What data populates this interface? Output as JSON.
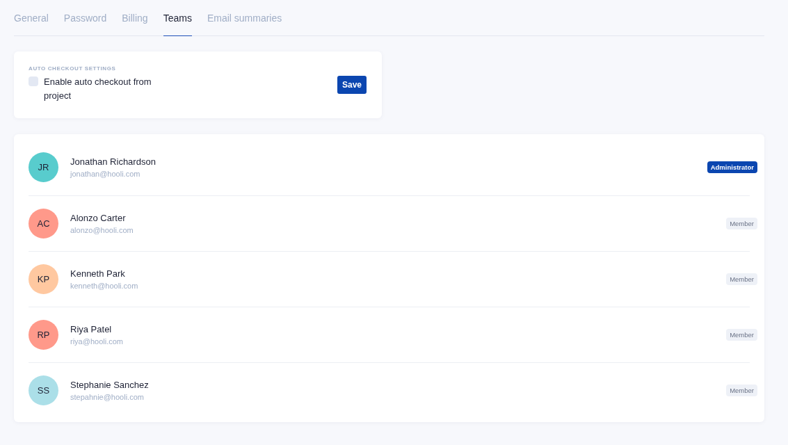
{
  "tabs": [
    {
      "label": "General",
      "selected": false
    },
    {
      "label": "Password",
      "selected": false
    },
    {
      "label": "Billing",
      "selected": false
    },
    {
      "label": "Teams",
      "selected": true
    },
    {
      "label": "Email summaries",
      "selected": false
    }
  ],
  "auto_checkout": {
    "heading": "AUTO CHECKOUT SETTINGS",
    "checkbox": {
      "label": "Enable auto checkout from project",
      "checked": false
    },
    "button": "Save"
  },
  "members": [
    {
      "initials": "JR",
      "color": "#58cccd",
      "name": "Jonathan Richardson",
      "email": "jonathan@hooli.com",
      "role": {
        "label": "Administrator",
        "kind": "admin"
      }
    },
    {
      "initials": "AC",
      "color": "#ff998a",
      "name": "Alonzo Carter",
      "email": "alonzo@hooli.com",
      "role": {
        "label": "Member",
        "kind": "member"
      }
    },
    {
      "initials": "KP",
      "color": "#ffc8a0",
      "name": "Kenneth Park",
      "email": "kenneth@hooli.com",
      "role": {
        "label": "Member",
        "kind": "member"
      }
    },
    {
      "initials": "RP",
      "color": "#ff998a",
      "name": "Riya Patel",
      "email": "riya@hooli.com",
      "role": {
        "label": "Member",
        "kind": "member"
      }
    },
    {
      "initials": "SS",
      "color": "#abdfe8",
      "name": "Stephanie Sanchez",
      "email": "stepahnie@hooli.com",
      "role": {
        "label": "Member",
        "kind": "member"
      }
    }
  ]
}
